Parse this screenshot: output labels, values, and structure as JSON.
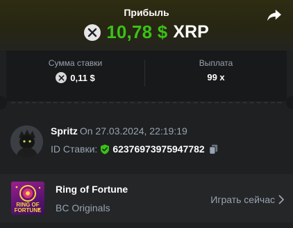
{
  "header": {
    "title": "Прибыль",
    "profit_amount": "10,78 $",
    "profit_currency": "XRP",
    "share_icon": "share-icon"
  },
  "stats": {
    "bet_label": "Сумма ставки",
    "bet_value": "0,11 $",
    "payout_label": "Выплата",
    "payout_value": "99 x"
  },
  "user": {
    "name": "Spritz",
    "time": "On 27.03.2024, 22:19:19",
    "bet_id_label": "ID Ставки:",
    "bet_id": "62376973975947782"
  },
  "game": {
    "thumb_line1": "RING OF",
    "thumb_line2": "FORTUNE",
    "title": "Ring of Fortune",
    "provider": "BC Originals",
    "play_label": "Играть сейчас"
  },
  "colors": {
    "profit_green": "#3bc117",
    "muted_text": "#99a4b0",
    "panel_dark": "#17191a",
    "background": "#1e2022"
  }
}
